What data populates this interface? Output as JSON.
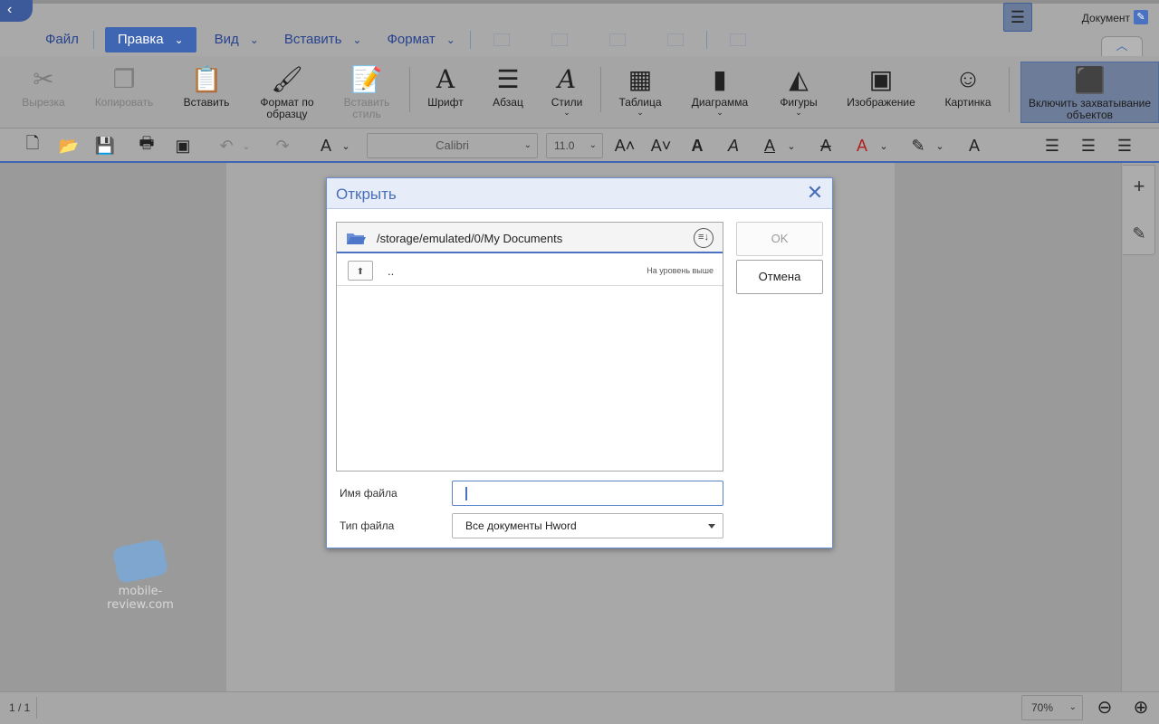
{
  "window": {
    "doc_label": "Документ"
  },
  "menu": {
    "items": [
      {
        "label": "Файл"
      },
      {
        "label": "Правка",
        "dropdown": true,
        "active": true
      },
      {
        "label": "Вид",
        "dropdown": true
      },
      {
        "label": "Вставить",
        "dropdown": true
      },
      {
        "label": "Формат",
        "dropdown": true
      }
    ]
  },
  "ribbon": {
    "cut": "Вырезка",
    "copy": "Копировать",
    "paste": "Вставить",
    "format_painter": "Формат по образцу",
    "paste_style": "Вставить стиль",
    "font": "Шрифт",
    "paragraph": "Абзац",
    "styles": "Стили",
    "table": "Таблица",
    "chart": "Диаграмма",
    "shapes": "Фигуры",
    "image": "Изображение",
    "clipart": "Картинка",
    "object_capture": "Включить захватывание объектов"
  },
  "toolbar": {
    "font_name": "Calibri",
    "font_size": "11.0"
  },
  "dialog": {
    "title": "Открыть",
    "path": "/storage/emulated/0/My Documents",
    "up_item": "..",
    "up_hint": "На уровень выше",
    "ok": "OK",
    "cancel": "Отмена",
    "filename_label": "Имя файла",
    "filename_value": "",
    "filetype_label": "Тип файла",
    "filetype_value": "Все документы Hword"
  },
  "status": {
    "page": "1 / 1",
    "zoom": "70%"
  },
  "watermark": "mobile-review.com",
  "colors": {
    "accent": "#3e66b2",
    "dialog_title": "#4a6fb8"
  }
}
